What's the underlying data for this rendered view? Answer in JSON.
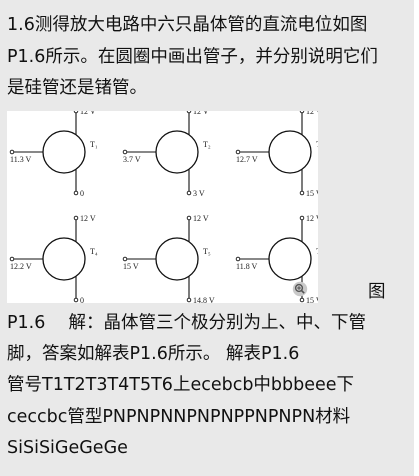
{
  "question": {
    "line1": "1.6测得放大电路中六只晶体管的直流电位如图",
    "line2": "P1.6所示。在圆圈中画出管子，并分别说明它们",
    "line3": "是硅管还是锗管。"
  },
  "figure": {
    "transistors": [
      {
        "label": "T₁",
        "top": "12 V",
        "left": "11.3 V",
        "bottom": "0"
      },
      {
        "label": "T₂",
        "top": "12 V",
        "left": "3.7 V",
        "bottom": "3 V"
      },
      {
        "label": "T₃",
        "top": "12 V",
        "left": "12.7 V",
        "bottom": "15 V"
      },
      {
        "label": "T₄",
        "top": "12 V",
        "left": "12.2 V",
        "bottom": "0"
      },
      {
        "label": "T₅",
        "top": "12 V",
        "left": "15 V",
        "bottom": "14.8 V"
      },
      {
        "label": "T₆",
        "top": "12 V",
        "left": "11.8 V",
        "bottom": "15 V"
      }
    ],
    "side_caption": "图"
  },
  "answer": {
    "line1": "P1.6　 解：晶体管三个极分别为上、中、下管",
    "line2": "脚，答案如解表P1.6所示。 解表P1.6",
    "line3": "管号T1T2T3T4T5T6上ecebcb中bbbeee下",
    "line4": "ceccbc管型PNPNPNNPNPNPPNPNPN材料",
    "line5": "SiSiSiGeGeGe"
  }
}
